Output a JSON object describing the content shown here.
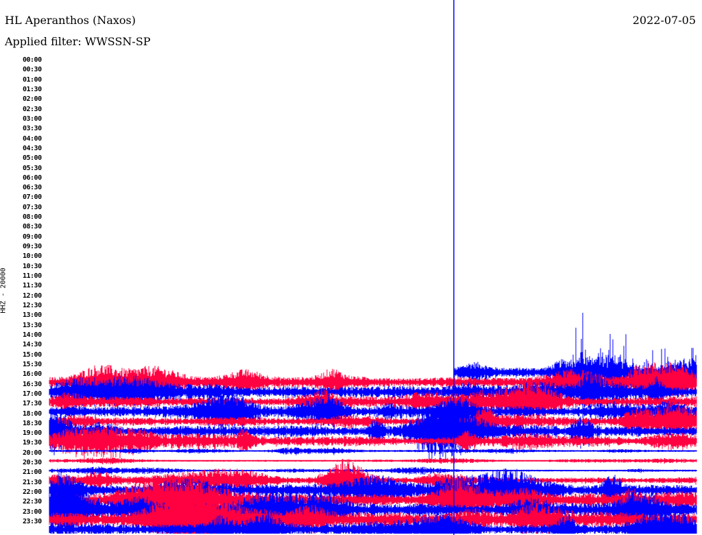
{
  "header": {
    "station": "HL Aperanthos (Naxos)",
    "filter": "Applied filter: WWSSN-SP",
    "date": "2022-07-05"
  },
  "colors": {
    "trace_a": "#ff0040",
    "trace_b": "#0000ff",
    "now_line": "#0000ff"
  },
  "chart_data": {
    "type": "line",
    "title": "HL Aperanthos (Naxos)",
    "ylabel": "HHZ - 20000",
    "xlabel": "",
    "row_labels": [
      "00:00",
      "00:30",
      "01:00",
      "01:30",
      "02:00",
      "02:30",
      "03:00",
      "03:30",
      "04:00",
      "04:30",
      "05:00",
      "05:30",
      "06:00",
      "06:30",
      "07:00",
      "07:30",
      "08:00",
      "08:30",
      "09:00",
      "09:30",
      "10:00",
      "10:30",
      "11:00",
      "11:30",
      "12:00",
      "12:30",
      "13:00",
      "13:30",
      "14:00",
      "14:30",
      "15:00",
      "15:30",
      "16:00",
      "16:30",
      "17:00",
      "17:30",
      "18:00",
      "18:30",
      "19:00",
      "19:30",
      "20:00",
      "20:30",
      "21:00",
      "21:30",
      "22:00",
      "22:30",
      "23:00",
      "23:30"
    ],
    "minutes_per_row": 30,
    "series": [
      {
        "row": "15:30",
        "level": 6,
        "start_fraction": 0.625
      },
      {
        "row": "16:00",
        "level": 8
      },
      {
        "row": "16:30",
        "level": 8
      },
      {
        "row": "17:00",
        "level": 7
      },
      {
        "row": "17:30",
        "level": 8
      },
      {
        "row": "18:00",
        "level": 6
      },
      {
        "row": "18:30",
        "level": 8
      },
      {
        "row": "19:00",
        "level": 7
      },
      {
        "row": "19:30",
        "level": 1.5
      },
      {
        "row": "20:00",
        "level": 1.5
      },
      {
        "row": "20:30",
        "level": 1.5
      },
      {
        "row": "21:00",
        "level": 5
      },
      {
        "row": "21:30",
        "level": 9
      },
      {
        "row": "22:00",
        "level": 9
      },
      {
        "row": "22:30",
        "level": 10
      },
      {
        "row": "23:00",
        "level": 10
      },
      {
        "row": "23:30",
        "level": 8
      }
    ],
    "current_time_fraction": 0.625
  }
}
